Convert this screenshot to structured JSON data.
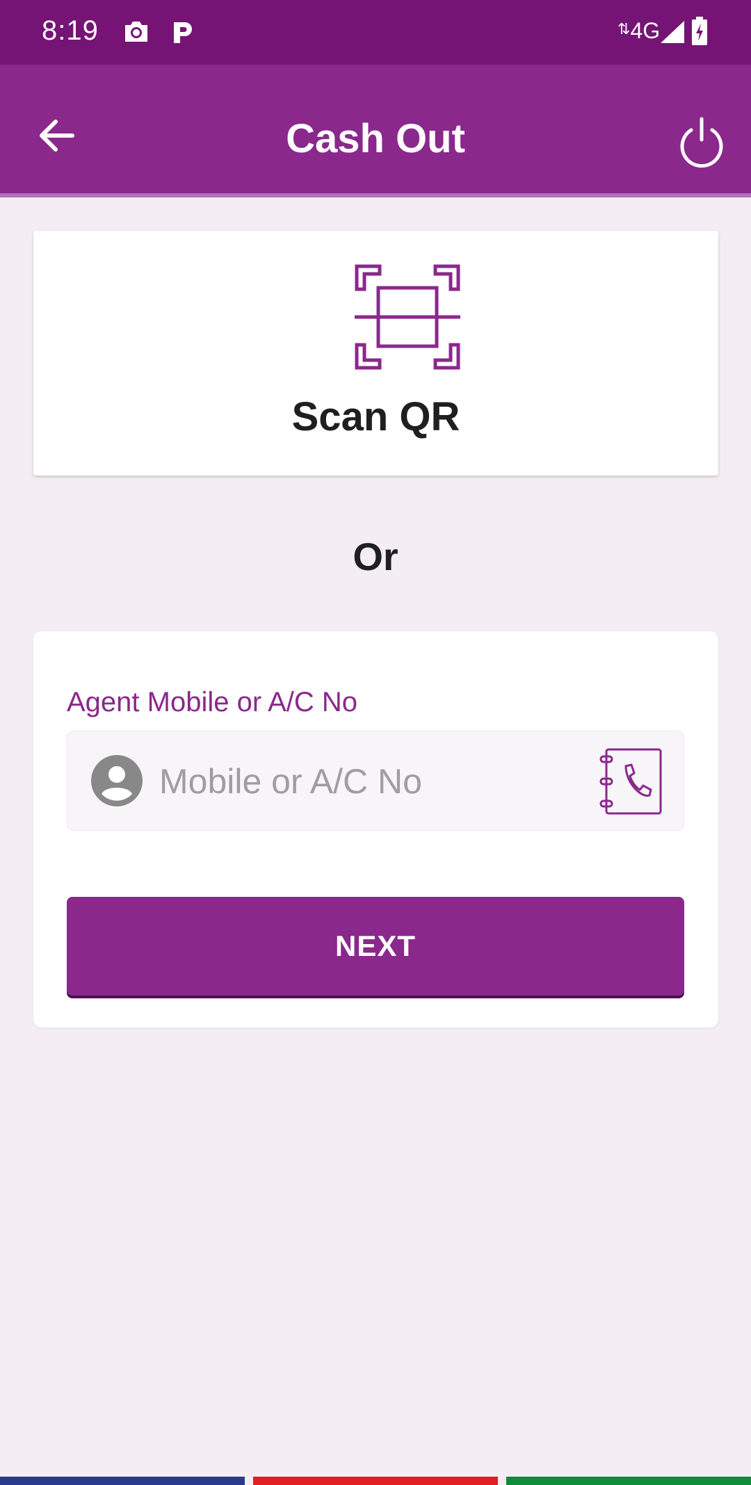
{
  "status_bar": {
    "time": "8:19",
    "network": "4G",
    "icons": [
      "camera-icon",
      "parking-p-icon",
      "data-arrows-icon",
      "signal-icon",
      "battery-charging-icon"
    ]
  },
  "app_bar": {
    "title": "Cash Out",
    "back_icon": "arrow-left-icon",
    "power_icon": "power-icon",
    "background_color": "#8a288c"
  },
  "scan": {
    "label": "Scan QR",
    "icon": "qr-scan-icon"
  },
  "divider_text": "Or",
  "form": {
    "field_label": "Agent Mobile or A/C No",
    "field_placeholder": "Mobile or A/C No",
    "field_value": "",
    "leading_icon": "person-circle-icon",
    "trailing_icon": "contact-book-icon",
    "next_label": "NEXT"
  },
  "colors": {
    "accent": "#8a288c",
    "status_bar": "#751474",
    "background": "#f4eef4",
    "stripes": [
      "#2b3a8c",
      "#e21d24",
      "#118a3b"
    ]
  }
}
